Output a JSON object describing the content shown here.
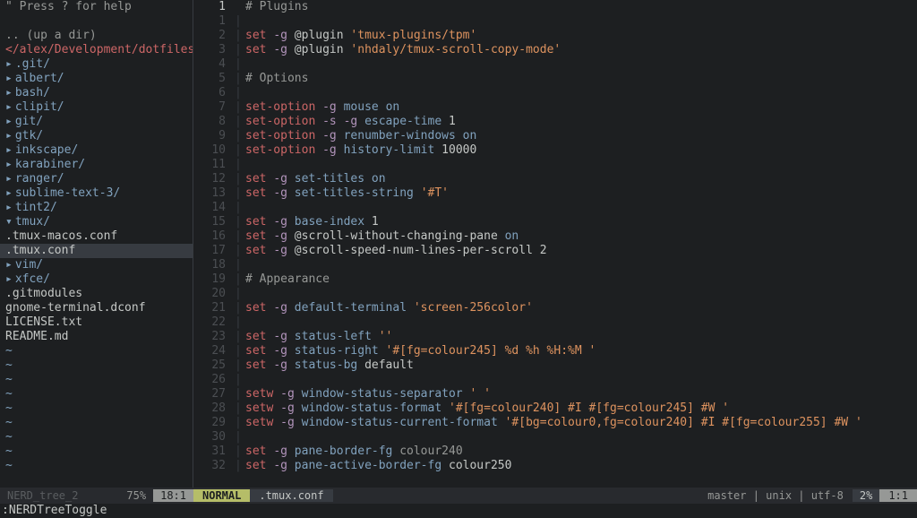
{
  "sidebar": {
    "help_hint": "\" Press ? for help",
    "updir": ".. (up a dir)",
    "path": "</alex/Development/dotfiles/",
    "items": [
      {
        "type": "folder",
        "expanded": false,
        "name": ".git/",
        "indent": 0,
        "selected": false
      },
      {
        "type": "folder",
        "expanded": false,
        "name": "albert/",
        "indent": 0,
        "selected": false
      },
      {
        "type": "folder",
        "expanded": false,
        "name": "bash/",
        "indent": 0,
        "selected": false
      },
      {
        "type": "folder",
        "expanded": false,
        "name": "clipit/",
        "indent": 0,
        "selected": false
      },
      {
        "type": "folder",
        "expanded": false,
        "name": "git/",
        "indent": 0,
        "selected": false
      },
      {
        "type": "folder",
        "expanded": false,
        "name": "gtk/",
        "indent": 0,
        "selected": false
      },
      {
        "type": "folder",
        "expanded": false,
        "name": "inkscape/",
        "indent": 0,
        "selected": false
      },
      {
        "type": "folder",
        "expanded": false,
        "name": "karabiner/",
        "indent": 0,
        "selected": false
      },
      {
        "type": "folder",
        "expanded": false,
        "name": "ranger/",
        "indent": 0,
        "selected": false
      },
      {
        "type": "folder",
        "expanded": false,
        "name": "sublime-text-3/",
        "indent": 0,
        "selected": false
      },
      {
        "type": "folder",
        "expanded": false,
        "name": "tint2/",
        "indent": 0,
        "selected": false
      },
      {
        "type": "folder",
        "expanded": true,
        "name": "tmux/",
        "indent": 0,
        "selected": false
      },
      {
        "type": "file",
        "name": ".tmux-macos.conf",
        "indent": 1,
        "selected": false
      },
      {
        "type": "file",
        "name": ".tmux.conf",
        "indent": 1,
        "selected": true
      },
      {
        "type": "folder",
        "expanded": false,
        "name": "vim/",
        "indent": 0,
        "selected": false
      },
      {
        "type": "folder",
        "expanded": false,
        "name": "xfce/",
        "indent": 0,
        "selected": false
      },
      {
        "type": "file",
        "name": ".gitmodules",
        "indent": 0,
        "selected": false
      },
      {
        "type": "file",
        "name": "gnome-terminal.dconf",
        "indent": 0,
        "selected": false
      },
      {
        "type": "file",
        "name": "LICENSE.txt",
        "indent": 0,
        "selected": false
      },
      {
        "type": "file",
        "name": "README.md",
        "indent": 0,
        "selected": false
      }
    ],
    "tildes": 9,
    "status_label": "NERD_tree_2",
    "status_pct": "75%",
    "status_pos": "18:1"
  },
  "editor": {
    "current_line_display": "1",
    "lines": [
      {
        "n": "1",
        "tokens": [
          {
            "c": "c-comment",
            "t": "# Plugins"
          }
        ],
        "current": true,
        "display_n": "1"
      },
      {
        "n": "1",
        "tokens": []
      },
      {
        "n": "2",
        "tokens": [
          {
            "c": "c-cmd",
            "t": "set"
          },
          {
            "c": "c-default",
            "t": " "
          },
          {
            "c": "c-flag",
            "t": "-g"
          },
          {
            "c": "c-default",
            "t": " "
          },
          {
            "c": "c-keyword",
            "t": "@plugin"
          },
          {
            "c": "c-default",
            "t": " "
          },
          {
            "c": "c-str",
            "t": "'tmux-plugins/tpm'"
          }
        ]
      },
      {
        "n": "3",
        "tokens": [
          {
            "c": "c-cmd",
            "t": "set"
          },
          {
            "c": "c-default",
            "t": " "
          },
          {
            "c": "c-flag",
            "t": "-g"
          },
          {
            "c": "c-default",
            "t": " "
          },
          {
            "c": "c-keyword",
            "t": "@plugin"
          },
          {
            "c": "c-default",
            "t": " "
          },
          {
            "c": "c-str",
            "t": "'nhdaly/tmux-scroll-copy-mode'"
          }
        ]
      },
      {
        "n": "4",
        "tokens": []
      },
      {
        "n": "5",
        "tokens": [
          {
            "c": "c-comment",
            "t": "# Options"
          }
        ]
      },
      {
        "n": "6",
        "tokens": []
      },
      {
        "n": "7",
        "tokens": [
          {
            "c": "c-cmd",
            "t": "set-option"
          },
          {
            "c": "c-default",
            "t": " "
          },
          {
            "c": "c-flag",
            "t": "-g"
          },
          {
            "c": "c-default",
            "t": " "
          },
          {
            "c": "c-key",
            "t": "mouse"
          },
          {
            "c": "c-default",
            "t": " "
          },
          {
            "c": "c-key",
            "t": "on"
          }
        ]
      },
      {
        "n": "8",
        "tokens": [
          {
            "c": "c-cmd",
            "t": "set-option"
          },
          {
            "c": "c-default",
            "t": " "
          },
          {
            "c": "c-flag",
            "t": "-s"
          },
          {
            "c": "c-default",
            "t": " "
          },
          {
            "c": "c-flag",
            "t": "-g"
          },
          {
            "c": "c-default",
            "t": " "
          },
          {
            "c": "c-key",
            "t": "escape-time"
          },
          {
            "c": "c-default",
            "t": " 1"
          }
        ]
      },
      {
        "n": "9",
        "tokens": [
          {
            "c": "c-cmd",
            "t": "set-option"
          },
          {
            "c": "c-default",
            "t": " "
          },
          {
            "c": "c-flag",
            "t": "-g"
          },
          {
            "c": "c-default",
            "t": " "
          },
          {
            "c": "c-key",
            "t": "renumber-windows"
          },
          {
            "c": "c-default",
            "t": " "
          },
          {
            "c": "c-key",
            "t": "on"
          }
        ]
      },
      {
        "n": "10",
        "tokens": [
          {
            "c": "c-cmd",
            "t": "set-option"
          },
          {
            "c": "c-default",
            "t": " "
          },
          {
            "c": "c-flag",
            "t": "-g"
          },
          {
            "c": "c-default",
            "t": " "
          },
          {
            "c": "c-key",
            "t": "history-limit"
          },
          {
            "c": "c-default",
            "t": " 10000"
          }
        ]
      },
      {
        "n": "11",
        "tokens": []
      },
      {
        "n": "12",
        "tokens": [
          {
            "c": "c-cmd",
            "t": "set"
          },
          {
            "c": "c-default",
            "t": " "
          },
          {
            "c": "c-flag",
            "t": "-g"
          },
          {
            "c": "c-default",
            "t": " "
          },
          {
            "c": "c-key",
            "t": "set-titles"
          },
          {
            "c": "c-default",
            "t": " "
          },
          {
            "c": "c-key",
            "t": "on"
          }
        ]
      },
      {
        "n": "13",
        "tokens": [
          {
            "c": "c-cmd",
            "t": "set"
          },
          {
            "c": "c-default",
            "t": " "
          },
          {
            "c": "c-flag",
            "t": "-g"
          },
          {
            "c": "c-default",
            "t": " "
          },
          {
            "c": "c-key",
            "t": "set-titles-string"
          },
          {
            "c": "c-default",
            "t": " "
          },
          {
            "c": "c-str",
            "t": "'#T'"
          }
        ]
      },
      {
        "n": "14",
        "tokens": []
      },
      {
        "n": "15",
        "tokens": [
          {
            "c": "c-cmd",
            "t": "set"
          },
          {
            "c": "c-default",
            "t": " "
          },
          {
            "c": "c-flag",
            "t": "-g"
          },
          {
            "c": "c-default",
            "t": " "
          },
          {
            "c": "c-key",
            "t": "base-index"
          },
          {
            "c": "c-default",
            "t": " 1"
          }
        ]
      },
      {
        "n": "16",
        "tokens": [
          {
            "c": "c-cmd",
            "t": "set"
          },
          {
            "c": "c-default",
            "t": " "
          },
          {
            "c": "c-flag",
            "t": "-g"
          },
          {
            "c": "c-default",
            "t": " "
          },
          {
            "c": "c-keyword",
            "t": "@scroll-without-changing-pane"
          },
          {
            "c": "c-default",
            "t": " "
          },
          {
            "c": "c-key",
            "t": "on"
          }
        ]
      },
      {
        "n": "17",
        "tokens": [
          {
            "c": "c-cmd",
            "t": "set"
          },
          {
            "c": "c-default",
            "t": " "
          },
          {
            "c": "c-flag",
            "t": "-g"
          },
          {
            "c": "c-default",
            "t": " "
          },
          {
            "c": "c-keyword",
            "t": "@scroll-speed-num-lines-per-scroll"
          },
          {
            "c": "c-default",
            "t": " 2"
          }
        ]
      },
      {
        "n": "18",
        "tokens": []
      },
      {
        "n": "19",
        "tokens": [
          {
            "c": "c-comment",
            "t": "# Appearance"
          }
        ]
      },
      {
        "n": "20",
        "tokens": []
      },
      {
        "n": "21",
        "tokens": [
          {
            "c": "c-cmd",
            "t": "set"
          },
          {
            "c": "c-default",
            "t": " "
          },
          {
            "c": "c-flag",
            "t": "-g"
          },
          {
            "c": "c-default",
            "t": " "
          },
          {
            "c": "c-key",
            "t": "default-terminal"
          },
          {
            "c": "c-default",
            "t": " "
          },
          {
            "c": "c-str",
            "t": "'screen-256color'"
          }
        ]
      },
      {
        "n": "22",
        "tokens": []
      },
      {
        "n": "23",
        "tokens": [
          {
            "c": "c-cmd",
            "t": "set"
          },
          {
            "c": "c-default",
            "t": " "
          },
          {
            "c": "c-flag",
            "t": "-g"
          },
          {
            "c": "c-default",
            "t": " "
          },
          {
            "c": "c-key",
            "t": "status-left"
          },
          {
            "c": "c-default",
            "t": " "
          },
          {
            "c": "c-str",
            "t": "''"
          }
        ]
      },
      {
        "n": "24",
        "tokens": [
          {
            "c": "c-cmd",
            "t": "set"
          },
          {
            "c": "c-default",
            "t": " "
          },
          {
            "c": "c-flag",
            "t": "-g"
          },
          {
            "c": "c-default",
            "t": " "
          },
          {
            "c": "c-key",
            "t": "status-right"
          },
          {
            "c": "c-default",
            "t": " "
          },
          {
            "c": "c-str",
            "t": "'#[fg=colour245] %d %h %H:%M '"
          }
        ]
      },
      {
        "n": "25",
        "tokens": [
          {
            "c": "c-cmd",
            "t": "set"
          },
          {
            "c": "c-default",
            "t": " "
          },
          {
            "c": "c-flag",
            "t": "-g"
          },
          {
            "c": "c-default",
            "t": " "
          },
          {
            "c": "c-key",
            "t": "status-bg"
          },
          {
            "c": "c-default",
            "t": " default"
          }
        ]
      },
      {
        "n": "26",
        "tokens": []
      },
      {
        "n": "27",
        "tokens": [
          {
            "c": "c-cmd",
            "t": "setw"
          },
          {
            "c": "c-default",
            "t": " "
          },
          {
            "c": "c-flag",
            "t": "-g"
          },
          {
            "c": "c-default",
            "t": " "
          },
          {
            "c": "c-key",
            "t": "window-status-separator"
          },
          {
            "c": "c-default",
            "t": " "
          },
          {
            "c": "c-str",
            "t": "' '"
          }
        ]
      },
      {
        "n": "28",
        "tokens": [
          {
            "c": "c-cmd",
            "t": "setw"
          },
          {
            "c": "c-default",
            "t": " "
          },
          {
            "c": "c-flag",
            "t": "-g"
          },
          {
            "c": "c-default",
            "t": " "
          },
          {
            "c": "c-key",
            "t": "window-status-format"
          },
          {
            "c": "c-default",
            "t": " "
          },
          {
            "c": "c-str",
            "t": "'#[fg=colour240] #I #[fg=colour245] #W '"
          }
        ]
      },
      {
        "n": "29",
        "tokens": [
          {
            "c": "c-cmd",
            "t": "setw"
          },
          {
            "c": "c-default",
            "t": " "
          },
          {
            "c": "c-flag",
            "t": "-g"
          },
          {
            "c": "c-default",
            "t": " "
          },
          {
            "c": "c-key",
            "t": "window-status-current-format"
          },
          {
            "c": "c-default",
            "t": " "
          },
          {
            "c": "c-str",
            "t": "'#[bg=colour0,fg=colour240] #I #[fg=colour255] #W '"
          }
        ]
      },
      {
        "n": "30",
        "tokens": []
      },
      {
        "n": "31",
        "tokens": [
          {
            "c": "c-cmd",
            "t": "set"
          },
          {
            "c": "c-default",
            "t": " "
          },
          {
            "c": "c-flag",
            "t": "-g"
          },
          {
            "c": "c-default",
            "t": " "
          },
          {
            "c": "c-key",
            "t": "pane-border-fg"
          },
          {
            "c": "c-default",
            "t": " "
          },
          {
            "c": "c-comment",
            "t": "colour240"
          }
        ]
      },
      {
        "n": "32",
        "tokens": [
          {
            "c": "c-cmd",
            "t": "set"
          },
          {
            "c": "c-default",
            "t": " "
          },
          {
            "c": "c-flag",
            "t": "-g"
          },
          {
            "c": "c-default",
            "t": " "
          },
          {
            "c": "c-key",
            "t": "pane-active-border-fg"
          },
          {
            "c": "c-default",
            "t": " colour250"
          }
        ]
      }
    ]
  },
  "status": {
    "mode": "NORMAL",
    "filename": ".tmux.conf",
    "git": "master | unix | utf-8",
    "pct": "2%",
    "pos": "1:1"
  },
  "cmdline": ":NERDTreeToggle"
}
